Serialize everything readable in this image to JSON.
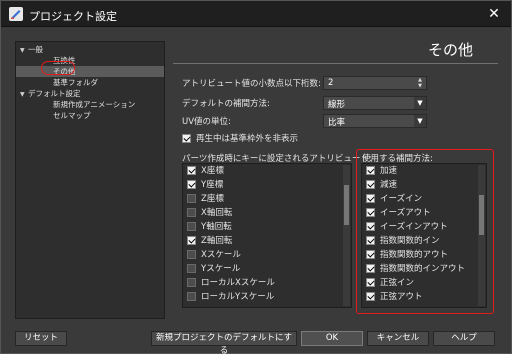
{
  "window": {
    "title": "プロジェクト設定",
    "close_label": "✕"
  },
  "tree": {
    "items": [
      {
        "label": "一般",
        "expanded": true
      },
      {
        "label": "互換性"
      },
      {
        "label": "その他",
        "selected": true
      },
      {
        "label": "基準フォルダ"
      },
      {
        "label": "デフォルト設定",
        "expanded": true
      },
      {
        "label": "新規作成アニメーション"
      },
      {
        "label": "セルマップ"
      }
    ]
  },
  "panel": {
    "title": "その他",
    "decimal_label": "アトリビュート値の小数点以下桁数:",
    "decimal_value": "2",
    "interp_label": "デフォルトの補間方法:",
    "interp_value": "線形",
    "uv_label": "UV値の単位:",
    "uv_value": "比率",
    "hide_out_of_frame_label": "再生中は基準枠外を非表示",
    "hide_out_of_frame_checked": true,
    "parts_attr_label": "パーツ作成時にキーに設定されるアトリビュート:",
    "interp_used_label": "使用する補間方法:"
  },
  "attributes": [
    {
      "label": "X座標",
      "checked": true
    },
    {
      "label": "Y座標",
      "checked": true
    },
    {
      "label": "Z座標",
      "checked": false
    },
    {
      "label": "X軸回転",
      "checked": false
    },
    {
      "label": "Y軸回転",
      "checked": false
    },
    {
      "label": "Z軸回転",
      "checked": true
    },
    {
      "label": "Xスケール",
      "checked": false
    },
    {
      "label": "Yスケール",
      "checked": false
    },
    {
      "label": "ローカルXスケール",
      "checked": false
    },
    {
      "label": "ローカルYスケール",
      "checked": false
    }
  ],
  "interpolations": [
    {
      "label": "加速",
      "checked": true
    },
    {
      "label": "減速",
      "checked": true
    },
    {
      "label": "イーズイン",
      "checked": true
    },
    {
      "label": "イーズアウト",
      "checked": true
    },
    {
      "label": "イーズインアウト",
      "checked": true
    },
    {
      "label": "指数関数的イン",
      "checked": true
    },
    {
      "label": "指数関数的アウト",
      "checked": true
    },
    {
      "label": "指数関数的インアウト",
      "checked": true
    },
    {
      "label": "正弦イン",
      "checked": true
    },
    {
      "label": "正弦アウト",
      "checked": true
    }
  ],
  "buttons": {
    "reset": "リセット",
    "set_default": "新規プロジェクトのデフォルトにする",
    "ok": "OK",
    "cancel": "キャンセル",
    "help": "ヘルプ"
  },
  "colors": {
    "highlight": "#e21b1b",
    "background": "#3a3a3a",
    "titlebar": "#1f1f1f"
  }
}
